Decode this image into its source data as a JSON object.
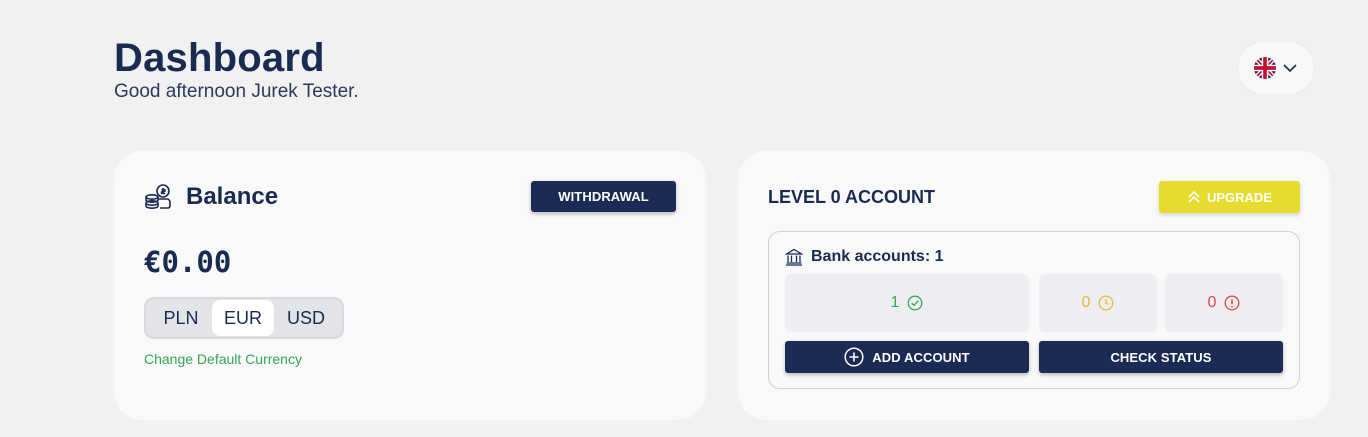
{
  "header": {
    "title": "Dashboard",
    "greeting": "Good afternoon Jurek Tester."
  },
  "language": {
    "flag_icon": "uk-flag-icon",
    "dropdown_icon": "chevron-down-icon"
  },
  "balance_card": {
    "icon": "coins-stack-icon",
    "title": "Balance",
    "withdraw_label": "WITHDRAWAL",
    "amount": "€0.00",
    "currencies": [
      "PLN",
      "EUR",
      "USD"
    ],
    "selected_currency": "EUR",
    "change_currency_label": "Change Default Currency"
  },
  "level_card": {
    "title": "LEVEL 0 ACCOUNT",
    "upgrade_label": "UPGRADE",
    "upgrade_icon": "double-chevron-up-icon",
    "bank_icon": "bank-building-icon",
    "bank_accounts_label": "Bank accounts: 1",
    "stats": {
      "verified": "1",
      "pending": "0",
      "rejected": "0"
    },
    "add_account_label": "ADD ACCOUNT",
    "check_status_label": "CHECK STATUS"
  },
  "colors": {
    "navy": "#1b2b55",
    "upgrade_yellow": "#e6dc2e",
    "success_green": "#35a853",
    "pending_amber": "#e9b936",
    "error_red": "#e04646"
  }
}
